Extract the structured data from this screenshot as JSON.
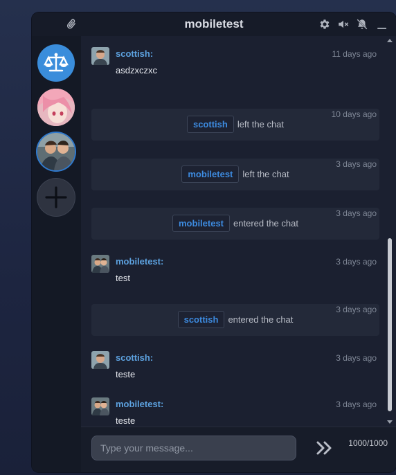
{
  "window": {
    "title": "mobiletest",
    "icons": [
      "paperclip-icon",
      "gear-icon",
      "volume-mute-icon",
      "bell-off-icon",
      "minimize-icon"
    ]
  },
  "sidebar": {
    "items": [
      {
        "name": "justice-scale-icon",
        "active": false
      },
      {
        "name": "avatar-anime",
        "active": false
      },
      {
        "name": "avatar-two-men",
        "active": true
      },
      {
        "name": "add-icon",
        "active": false
      }
    ]
  },
  "messages": [
    {
      "type": "message",
      "author": "scottish:",
      "time": "11 days ago",
      "text": "asdzxczxc",
      "avatar": "man"
    },
    {
      "type": "event",
      "user": "scottish",
      "action": "left the chat",
      "time": "10 days ago"
    },
    {
      "type": "event",
      "user": "mobiletest",
      "action": "left the chat",
      "time": "3 days ago"
    },
    {
      "type": "event",
      "user": "mobiletest",
      "action": "entered the chat",
      "time": "3 days ago"
    },
    {
      "type": "message",
      "author": "mobiletest:",
      "time": "3 days ago",
      "text": "test",
      "avatar": "two-men"
    },
    {
      "type": "event",
      "user": "scottish",
      "action": "entered the chat",
      "time": "3 days ago"
    },
    {
      "type": "message",
      "author": "scottish:",
      "time": "3 days ago",
      "text": "teste",
      "avatar": "man"
    },
    {
      "type": "message",
      "author": "mobiletest:",
      "time": "3 days ago",
      "text": "teste",
      "avatar": "two-men"
    }
  ],
  "composer": {
    "placeholder": "Type your message...",
    "counter": "1000/1000"
  },
  "colors": {
    "accent": "#3d8be0",
    "author": "#5da2e0",
    "background": "#1b2030"
  }
}
